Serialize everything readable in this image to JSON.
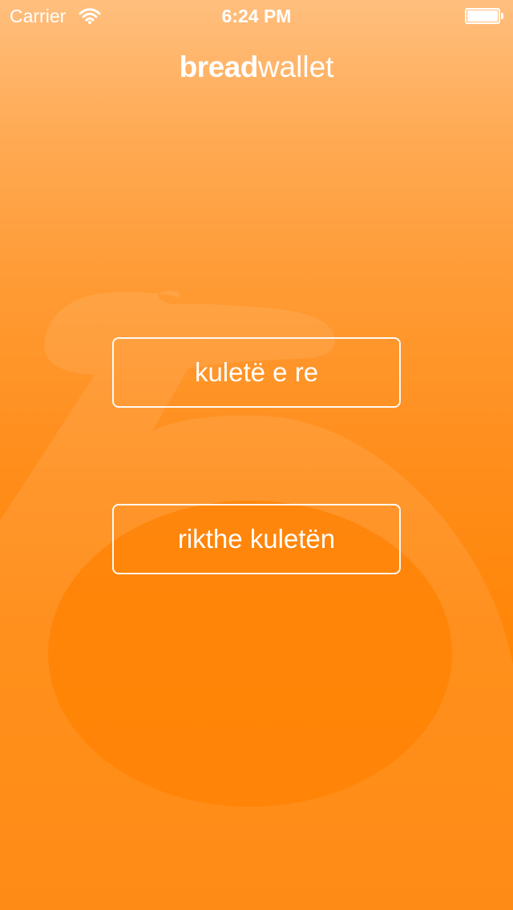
{
  "status_bar": {
    "carrier": "Carrier",
    "time": "6:24 PM",
    "battery_level": 1.0
  },
  "brand": {
    "bread": "bread",
    "wallet": "wallet"
  },
  "actions": {
    "new_wallet": "kuletë e re",
    "restore_wallet": "rikthe kuletën"
  },
  "colors": {
    "gradient_top": "#ffbf7e",
    "gradient_bottom": "#ff8000",
    "text": "#ffffff"
  },
  "icons": {
    "wifi": "wifi-icon",
    "battery": "battery-icon",
    "background_logo": "breadwallet-b-logo-watermark"
  }
}
